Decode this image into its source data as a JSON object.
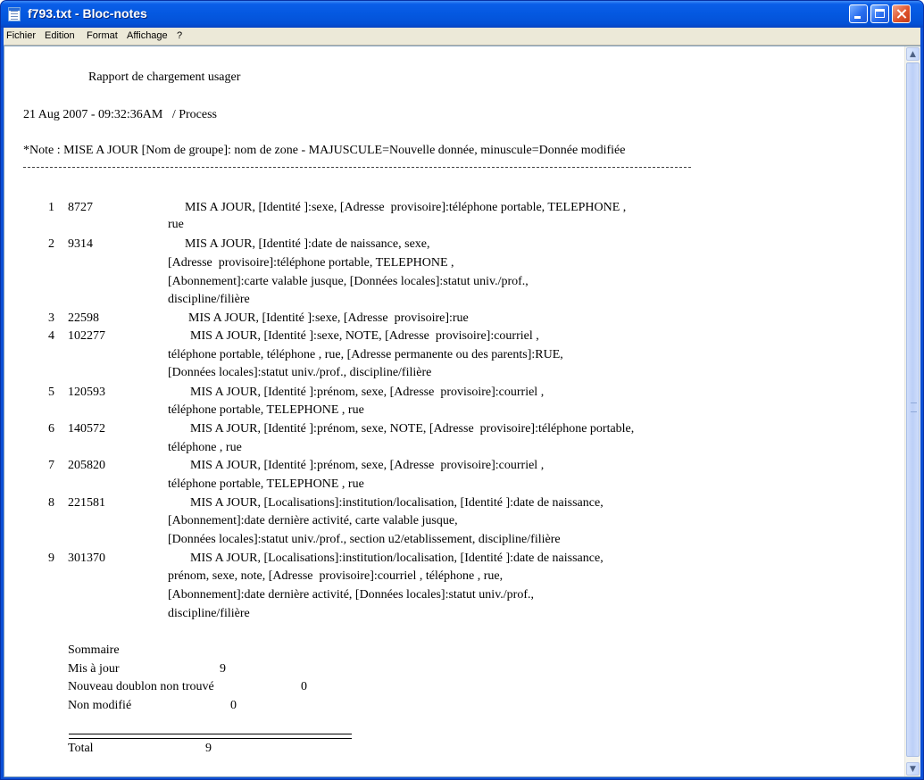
{
  "window": {
    "title": "f793.txt - Bloc-notes"
  },
  "menu": [
    "Fichier",
    "Edition",
    "Format",
    "Affichage",
    "?"
  ],
  "doc": {
    "title": "Rapport de chargement usager",
    "date": "21 Aug 2007 - 09:32:36AM   / Process",
    "note": "*Note : MISE A JOUR [Nom de groupe]: nom de zone - MAJUSCULE=Nouvelle donnée, minuscule=Donnée modifiée",
    "records": [
      {
        "num": "1",
        "id": "8727",
        "lines": [
          "MIS A JOUR, [Identité ]:sexe, [Adresse  provisoire]:téléphone portable, TELEPHONE ,",
          "rue"
        ]
      },
      {
        "num": "2",
        "id": "9314",
        "lines": [
          "MIS A JOUR, [Identité ]:date de naissance, sexe,",
          "[Adresse  provisoire]:téléphone portable, TELEPHONE ,",
          "[Abonnement]:carte valable jusque, [Données locales]:statut univ./prof.,",
          "discipline/filière"
        ]
      },
      {
        "num": "3",
        "id": "22598",
        "lines": [
          "MIS A JOUR, [Identité ]:sexe, [Adresse  provisoire]:rue"
        ]
      },
      {
        "num": "4",
        "id": "102277",
        "lines": [
          "MIS A JOUR, [Identité ]:sexe, NOTE, [Adresse  provisoire]:courriel ,",
          "téléphone portable, téléphone , rue, [Adresse permanente ou des parents]:RUE,",
          "[Données locales]:statut univ./prof., discipline/filière"
        ]
      },
      {
        "num": "5",
        "id": "120593",
        "lines": [
          "MIS A JOUR, [Identité ]:prénom, sexe, [Adresse  provisoire]:courriel ,",
          "téléphone portable, TELEPHONE , rue"
        ]
      },
      {
        "num": "6",
        "id": "140572",
        "lines": [
          "MIS A JOUR, [Identité ]:prénom, sexe, NOTE, [Adresse  provisoire]:téléphone portable,",
          "téléphone , rue"
        ]
      },
      {
        "num": "7",
        "id": "205820",
        "lines": [
          "MIS A JOUR, [Identité ]:prénom, sexe, [Adresse  provisoire]:courriel ,",
          "téléphone portable, TELEPHONE , rue"
        ]
      },
      {
        "num": "8",
        "id": "221581",
        "lines": [
          "MIS A JOUR, [Localisations]:institution/localisation, [Identité ]:date de naissance,",
          "[Abonnement]:date dernière activité, carte valable jusque,",
          "[Données locales]:statut univ./prof., section u2/etablissement, discipline/filière"
        ]
      },
      {
        "num": "9",
        "id": "301370",
        "lines": [
          "MIS A JOUR, [Localisations]:institution/localisation, [Identité ]:date de naissance,",
          "prénom, sexe, note, [Adresse  provisoire]:courriel , téléphone , rue,",
          "[Abonnement]:date dernière activité, [Données locales]:statut univ./prof.,",
          "discipline/filière"
        ]
      }
    ],
    "summary": {
      "title": "Sommaire",
      "rows": [
        {
          "label": "Mis à jour",
          "value": "9"
        },
        {
          "label": "Nouveau doublon non trouvé",
          "value": "0"
        },
        {
          "label": "Non modifié",
          "value": "0"
        }
      ],
      "total_label": "Total",
      "total_value": "9"
    }
  }
}
